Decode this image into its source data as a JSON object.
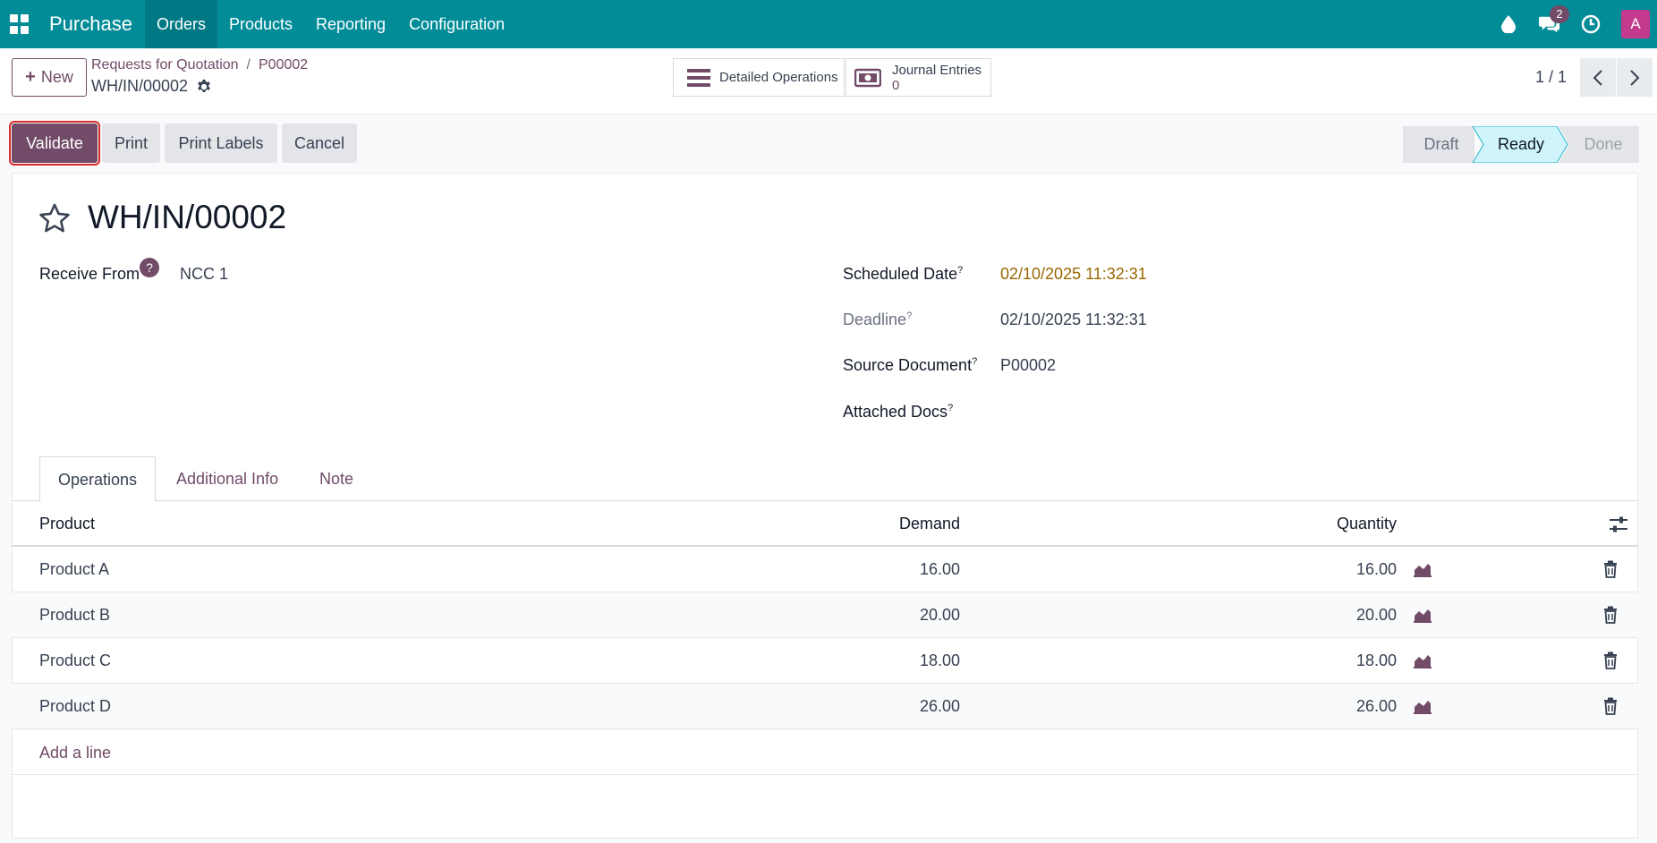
{
  "navbar": {
    "brand": "Purchase",
    "menu": [
      "Orders",
      "Products",
      "Reporting",
      "Configuration"
    ],
    "chat_badge": "2",
    "avatar_letter": "A"
  },
  "control": {
    "new_label": "New",
    "breadcrumb": [
      "Requests for Quotation",
      "P00002"
    ],
    "record": "WH/IN/00002",
    "smart_ops": "Detailed Operations",
    "smart_je_label": "Journal Entries",
    "smart_je_count": "0",
    "pager": "1 / 1"
  },
  "actions": {
    "validate": "Validate",
    "print": "Print",
    "print_labels": "Print Labels",
    "cancel": "Cancel"
  },
  "status": {
    "stages": [
      "Draft",
      "Ready",
      "Done"
    ],
    "current": "Ready"
  },
  "form": {
    "title": "WH/IN/00002",
    "receive_from_label": "Receive From",
    "receive_from_value": "NCC 1",
    "help_mark": "?",
    "tooltip_mark": "?",
    "scheduled_label": "Scheduled Date",
    "scheduled_value": "02/10/2025 11:32:31",
    "deadline_label": "Deadline",
    "deadline_value": "02/10/2025 11:32:31",
    "source_label": "Source Document",
    "source_value": "P00002",
    "attached_label": "Attached Docs"
  },
  "tabs": [
    "Operations",
    "Additional Info",
    "Note"
  ],
  "table": {
    "headers": [
      "Product",
      "Demand",
      "Quantity"
    ],
    "rows": [
      {
        "product": "Product A",
        "demand": "16.00",
        "quantity": "16.00"
      },
      {
        "product": "Product B",
        "demand": "20.00",
        "quantity": "20.00"
      },
      {
        "product": "Product C",
        "demand": "18.00",
        "quantity": "18.00"
      },
      {
        "product": "Product D",
        "demand": "26.00",
        "quantity": "26.00"
      }
    ],
    "add_line": "Add a line"
  },
  "colors": {
    "navbar": "#018c98",
    "primary": "#714b67",
    "ready_stage": "#cff4fc",
    "deadline_date": "#9a6700"
  }
}
